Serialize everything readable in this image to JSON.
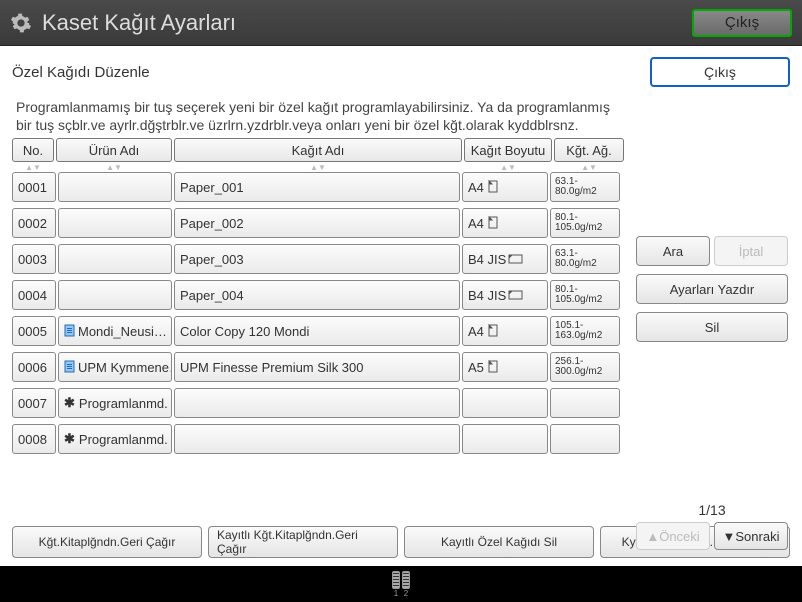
{
  "titlebar": {
    "title": "Kaset Kağıt Ayarları",
    "exit": "Çıkış"
  },
  "subheader": {
    "title": "Özel Kağıdı Düzenle",
    "close": "Çıkış"
  },
  "instructions": {
    "line1": "Programlanmamış bir tuş seçerek yeni bir özel kağıt programlayabilirsiniz. Ya da programlanmış",
    "line2": "bir tuş sçblr.ve ayrlr.dğştrblr.ve üzrlrn.yzdrblr.veya onları yeni bir özel kğt.olarak kyddblrsnz."
  },
  "headers": {
    "no": "No.",
    "product": "Ürün Adı",
    "name": "Kağıt Adı",
    "size": "Kağıt Boyutu",
    "weight": "Kğt. Ağ."
  },
  "rows": [
    {
      "no": "0001",
      "product": "",
      "name": "Paper_001",
      "size": "A4",
      "orient": "portrait",
      "weight": "63.1-80.0g/m2"
    },
    {
      "no": "0002",
      "product": "",
      "name": "Paper_002",
      "size": "A4",
      "orient": "portrait",
      "weight": "80.1-105.0g/m2"
    },
    {
      "no": "0003",
      "product": "",
      "name": "Paper_003",
      "size": "B4 JIS",
      "orient": "landscape",
      "weight": "63.1-80.0g/m2"
    },
    {
      "no": "0004",
      "product": "",
      "name": "Paper_004",
      "size": "B4 JIS",
      "orient": "landscape",
      "weight": "80.1-105.0g/m2"
    },
    {
      "no": "0005",
      "product": "Mondi_Neusi…",
      "prodIcon": true,
      "name": "Color Copy 120 Mondi",
      "size": "A4",
      "orient": "portrait",
      "weight": "105.1-163.0g/m2"
    },
    {
      "no": "0006",
      "product": "UPM Kymmene…",
      "prodIcon": true,
      "name": "UPM Finesse Premium Silk 300",
      "size": "A5",
      "orient": "portrait",
      "weight": "256.1-300.0g/m2"
    },
    {
      "no": "0007",
      "product": "✱ Programlanmd.",
      "star": true,
      "name": "",
      "size": "",
      "weight": ""
    },
    {
      "no": "0008",
      "product": "✱ Programlanmd.",
      "star": true,
      "name": "",
      "size": "",
      "weight": ""
    }
  ],
  "sidebuttons": {
    "search": "Ara",
    "cancel": "İptal",
    "print": "Ayarları Yazdır",
    "delete": "Sil"
  },
  "pager": {
    "text": "1/13",
    "prev": "Önceki",
    "next": "Sonraki"
  },
  "bottom": {
    "b1": "Kğt.Kitaplğndn.Geri Çağır",
    "b2": "Kayıtlı Kğt.Kitaplğndn.Geri Çağır",
    "b3": "Kayıtlı Özel Kağıdı Sil",
    "b4": "Kytl.Kğt.Kitaplğn.Programla"
  },
  "footer": {
    "t1": "1",
    "t2": "2"
  }
}
